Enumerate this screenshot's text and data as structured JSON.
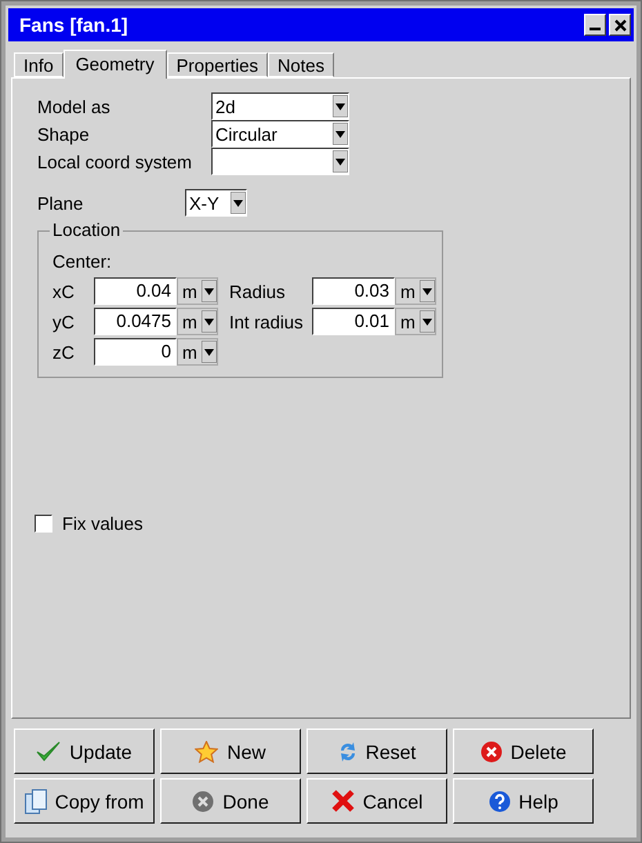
{
  "window": {
    "title": "Fans [fan.1]"
  },
  "tabs": [
    {
      "label": "Info",
      "selected": false
    },
    {
      "label": "Geometry",
      "selected": true
    },
    {
      "label": "Properties",
      "selected": false
    },
    {
      "label": "Notes",
      "selected": false
    }
  ],
  "fields": [
    {
      "label": "Model as",
      "value": "2d"
    },
    {
      "label": "Shape",
      "value": "Circular"
    },
    {
      "label": "Local coord system"
    }
  ],
  "plane": {
    "label": "Plane",
    "value": "X-Y"
  },
  "location": {
    "title": "Location",
    "subtitle": "Center:",
    "left": [
      {
        "label": "xC",
        "value": "0.04",
        "unit": "m"
      },
      {
        "label": "yC",
        "value": "0.0475",
        "unit": "m"
      },
      {
        "label": "zC",
        "value": "0",
        "unit": "m"
      }
    ],
    "right": [
      {
        "label": "Radius",
        "value": "0.03",
        "unit": "m"
      },
      {
        "label": "Int radius",
        "value": "0.01",
        "unit": "m"
      }
    ]
  },
  "fix_values": {
    "label": "Fix values",
    "checked": false
  },
  "buttons": [
    "Update",
    "New",
    "Reset",
    "Delete",
    "Copy from",
    "Done",
    "Cancel",
    "Help"
  ]
}
